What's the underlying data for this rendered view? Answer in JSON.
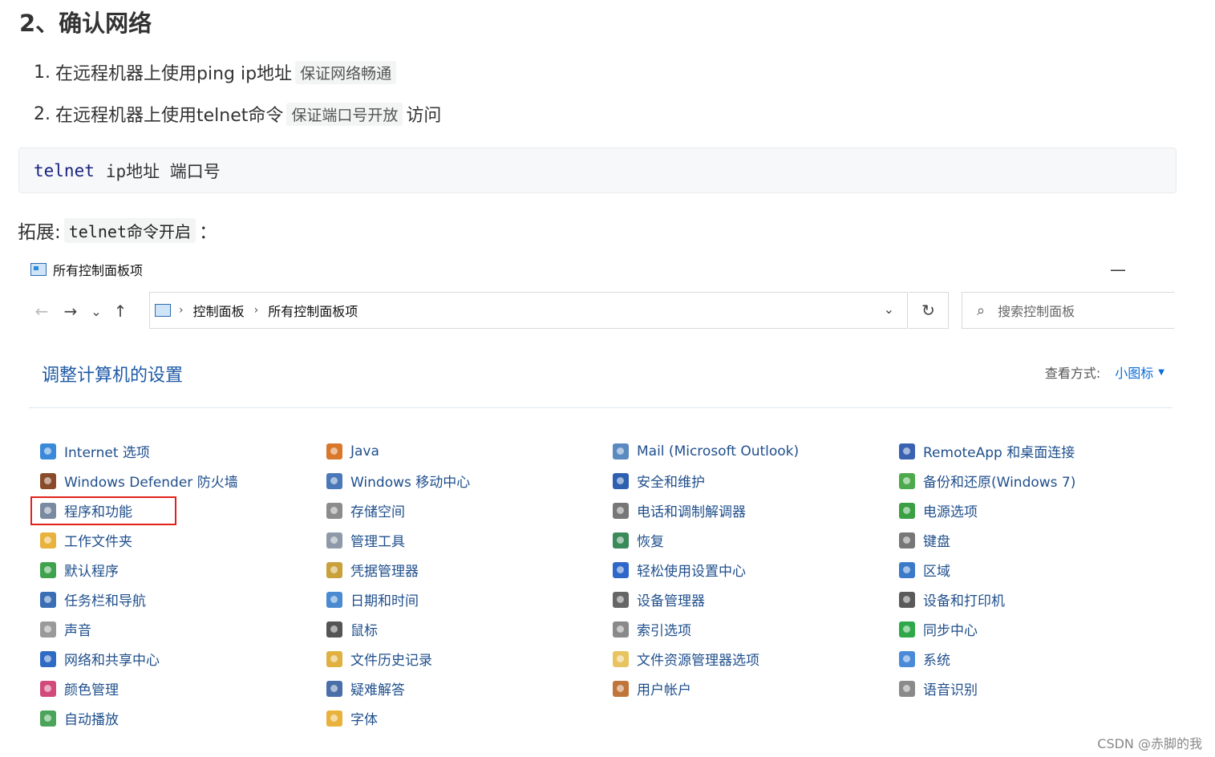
{
  "heading": "2、确认网络",
  "steps": [
    {
      "num": "1.",
      "text": "在远程机器上使用ping ip地址",
      "code": "保证网络畅通",
      "after": ""
    },
    {
      "num": "2.",
      "text": "在远程机器上使用telnet命令",
      "code": "保证端口号开放",
      "after": "访问"
    }
  ],
  "codeblock": {
    "keyword": "telnet",
    "args": "ip地址 端口号"
  },
  "extension": {
    "prefix": "拓展:",
    "code": "telnet命令开启",
    "suffix": "："
  },
  "window": {
    "title": "所有控制面板项",
    "minimize": "—",
    "nav": {
      "back": "←",
      "forward": "→",
      "recent": "⌄",
      "up": "↑"
    },
    "address": {
      "crumbs": [
        "控制面板",
        "所有控制面板项"
      ],
      "separator": "›",
      "dropdown": "⌄"
    },
    "refresh": "↻",
    "search": {
      "icon": "search-icon",
      "placeholder": "搜索控制面板"
    },
    "adjust_title": "调整计算机的设置",
    "view_by": {
      "label": "查看方式:",
      "value": "小图标",
      "caret": "▼"
    }
  },
  "columns": [
    [
      {
        "label": "Internet 选项",
        "icon": "globe-icon",
        "color": "#3b8ad9"
      },
      {
        "label": "Windows Defender 防火墙",
        "icon": "firewall-icon",
        "color": "#8a4b2a"
      },
      {
        "label": "程序和功能",
        "icon": "programs-icon",
        "color": "#7a8aa0"
      },
      {
        "label": "工作文件夹",
        "icon": "folder-icon",
        "color": "#e8b23c"
      },
      {
        "label": "默认程序",
        "icon": "default-programs-icon",
        "color": "#3fa34d"
      },
      {
        "label": "任务栏和导航",
        "icon": "taskbar-icon",
        "color": "#3a6fb5"
      },
      {
        "label": "声音",
        "icon": "speaker-icon",
        "color": "#9a9a9a"
      },
      {
        "label": "网络和共享中心",
        "icon": "network-icon",
        "color": "#2f6ac4"
      },
      {
        "label": "颜色管理",
        "icon": "color-icon",
        "color": "#d24a7a"
      },
      {
        "label": "自动播放",
        "icon": "autoplay-icon",
        "color": "#4aa45a"
      }
    ],
    [
      {
        "label": "Java",
        "icon": "java-icon",
        "color": "#d9772b"
      },
      {
        "label": "Windows 移动中心",
        "icon": "mobility-icon",
        "color": "#4a78b8"
      },
      {
        "label": "存储空间",
        "icon": "storage-icon",
        "color": "#8c8c8c"
      },
      {
        "label": "管理工具",
        "icon": "tools-icon",
        "color": "#8f9aa8"
      },
      {
        "label": "凭据管理器",
        "icon": "credential-icon",
        "color": "#c9a03a"
      },
      {
        "label": "日期和时间",
        "icon": "clock-icon",
        "color": "#4a8ad0"
      },
      {
        "label": "鼠标",
        "icon": "mouse-icon",
        "color": "#555555"
      },
      {
        "label": "文件历史记录",
        "icon": "file-history-icon",
        "color": "#e0b040"
      },
      {
        "label": "疑难解答",
        "icon": "troubleshoot-icon",
        "color": "#4a6ea8"
      },
      {
        "label": "字体",
        "icon": "font-icon",
        "color": "#e8b23c"
      }
    ],
    [
      {
        "label": "Mail (Microsoft Outlook)",
        "icon": "mail-icon",
        "color": "#5a8ac0"
      },
      {
        "label": "安全和维护",
        "icon": "flag-icon",
        "color": "#2f5fb0"
      },
      {
        "label": "电话和调制解调器",
        "icon": "phone-icon",
        "color": "#777777"
      },
      {
        "label": "恢复",
        "icon": "recovery-icon",
        "color": "#3a8a5a"
      },
      {
        "label": "轻松使用设置中心",
        "icon": "ease-of-access-icon",
        "color": "#2f68c8"
      },
      {
        "label": "设备管理器",
        "icon": "device-manager-icon",
        "color": "#666666"
      },
      {
        "label": "索引选项",
        "icon": "indexing-icon",
        "color": "#8a8a8a"
      },
      {
        "label": "文件资源管理器选项",
        "icon": "explorer-options-icon",
        "color": "#e8c460"
      },
      {
        "label": "用户帐户",
        "icon": "users-icon",
        "color": "#c0763a"
      }
    ],
    [
      {
        "label": "RemoteApp 和桌面连接",
        "icon": "remoteapp-icon",
        "color": "#3a62b0"
      },
      {
        "label": "备份和还原(Windows 7)",
        "icon": "backup-icon",
        "color": "#4caa4c"
      },
      {
        "label": "电源选项",
        "icon": "power-icon",
        "color": "#3aa043"
      },
      {
        "label": "键盘",
        "icon": "keyboard-icon",
        "color": "#777777"
      },
      {
        "label": "区域",
        "icon": "region-icon",
        "color": "#3a7ac8"
      },
      {
        "label": "设备和打印机",
        "icon": "printer-icon",
        "color": "#5a5a5a"
      },
      {
        "label": "同步中心",
        "icon": "sync-icon",
        "color": "#2fa84a"
      },
      {
        "label": "系统",
        "icon": "system-icon",
        "color": "#4a8ad8"
      },
      {
        "label": "语音识别",
        "icon": "microphone-icon",
        "color": "#8a8a8a"
      }
    ]
  ],
  "watermark": "CSDN @赤脚的我"
}
